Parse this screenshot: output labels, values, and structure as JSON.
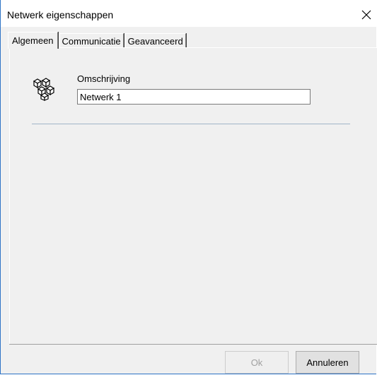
{
  "window": {
    "title": "Netwerk eigenschappen",
    "close_icon": "close-icon"
  },
  "tabs": [
    {
      "label": "Algemeen",
      "active": true
    },
    {
      "label": "Communicatie",
      "active": false
    },
    {
      "label": "Geavanceerd",
      "active": false
    }
  ],
  "general": {
    "icon": "network-cubes-icon",
    "description_label": "Omschrijving",
    "description_value": "Netwerk 1"
  },
  "buttons": {
    "ok_label": "Ok",
    "ok_enabled": false,
    "cancel_label": "Annuleren"
  }
}
